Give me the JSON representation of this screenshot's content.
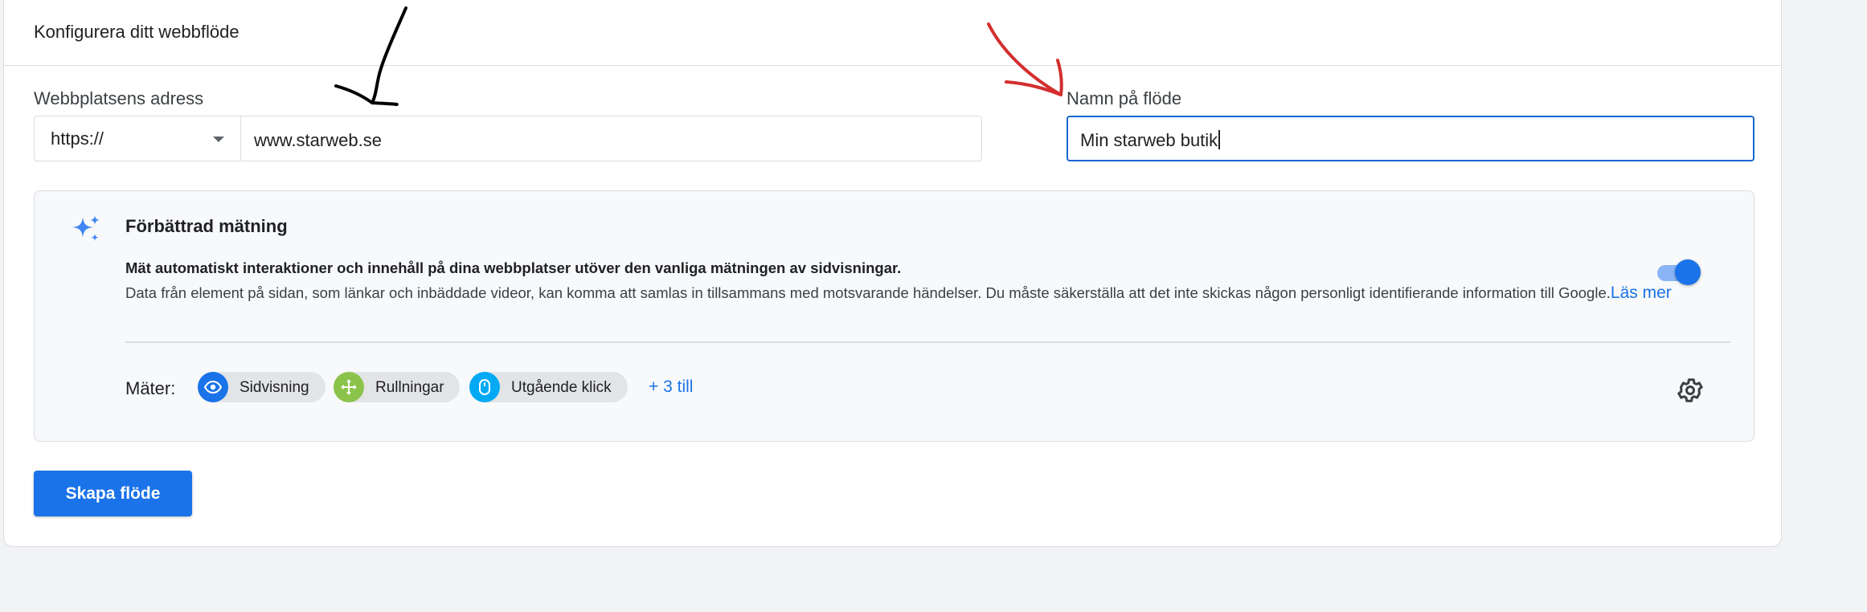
{
  "card": {
    "title": "Konfigurera ditt webbflöde"
  },
  "website": {
    "label": "Webbplatsens adress",
    "protocol": "https://",
    "url_value": "www.starweb.se"
  },
  "stream_name": {
    "label": "Namn på flöde",
    "value": "Min starweb butik"
  },
  "enhanced": {
    "title": "Förbättrad mätning",
    "description_bold": "Mät automatiskt interaktioner och innehåll på dina webbplatser utöver den vanliga mätningen av sidvisningar.",
    "description": "Data från element på sidan, som länkar och inbäddade videor, kan komma att samlas in tillsammans med motsvarande händelser. Du måste säkerställa att det inte skickas någon personligt identifierande information till Google.",
    "learn_more": "Läs mer",
    "enabled": true,
    "measures_label": "Mäter:",
    "chips": [
      {
        "label": "Sidvisning",
        "icon": "eye-icon",
        "color": "#1a73e8"
      },
      {
        "label": "Rullningar",
        "icon": "move-arrows-icon",
        "color": "#8bc34a"
      },
      {
        "label": "Utgående klick",
        "icon": "mouse-icon",
        "color": "#03a9f4"
      }
    ],
    "more": "+ 3 till"
  },
  "actions": {
    "create_label": "Skapa flöde"
  },
  "colors": {
    "accent": "#1a73e8",
    "annotation_black": "#000000",
    "annotation_red": "#d32f2f"
  }
}
